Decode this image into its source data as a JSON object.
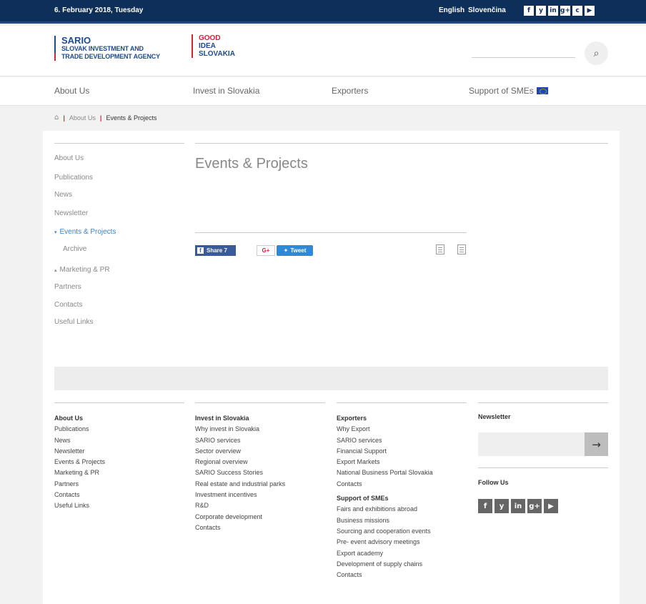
{
  "topbar": {
    "date": "6. February 2018, Tuesday",
    "lang_en": "English",
    "lang_sk": "Slovenčina",
    "social": [
      "f",
      "y",
      "in",
      "g+",
      "c",
      "▶"
    ]
  },
  "header": {
    "sario_name": "SARIO",
    "sario_sub1": "SLOVAK INVESTMENT AND",
    "sario_sub2": "TRADE DEVELOPMENT AGENCY",
    "good1": "GOOD",
    "good2": "IDEA",
    "good3": "SLOVAKIA",
    "search_icon": "⌕"
  },
  "mainnav": {
    "items": [
      "About Us",
      "Invest in Slovakia",
      "Exporters",
      "Support of SMEs"
    ]
  },
  "breadcrumb": {
    "home_icon": "⌂",
    "sep": "|",
    "items": [
      "About Us",
      "Events & Projects"
    ]
  },
  "leftnav": {
    "items": [
      "About Us",
      "Publications",
      "News",
      "Newsletter",
      "Events & Projects",
      "Archive",
      "Marketing & PR",
      "Partners",
      "Contacts",
      "Useful Links"
    ],
    "expanded_marker": "▾",
    "collapsed_marker": "▴"
  },
  "main": {
    "title": "Events & Projects",
    "share_label": "Share 7",
    "gplus_label": "G+",
    "tweet_label": "Tweet"
  },
  "footer": {
    "col1": {
      "items": [
        "About Us",
        "Publications",
        "News",
        "Newsletter",
        "Events & Projects",
        "Marketing & PR",
        "Partners",
        "Contacts",
        "Useful Links"
      ]
    },
    "col2": {
      "heading": "Invest in Slovakia",
      "items": [
        "Why invest in Slovakia",
        "SARIO services",
        "Sector overview",
        "Regional overview",
        "SARIO Success Stories",
        "Real estate and industrial parks",
        "Investment incentives",
        "R&D",
        "Corporate development",
        "Contacts"
      ]
    },
    "col3": {
      "heading": "Exporters",
      "items": [
        "Why Export",
        "SARIO services",
        "Financial Support",
        "Export Markets",
        "National Business Portal Slovakia",
        "Contacts"
      ],
      "heading2": "Support of SMEs",
      "items2": [
        "Fairs and exhibitions abroad",
        "Business missions",
        "Sourcing and cooperation events",
        "Pre- event advisory meetings",
        "Export academy",
        "Development of supply chains",
        "Contacts"
      ]
    },
    "newsletter_title": "Newsletter",
    "newsletter_arrow": "→",
    "follow_title": "Follow Us",
    "follow_icons": [
      "f",
      "y",
      "in",
      "g+",
      "▶"
    ]
  },
  "colors": {
    "topbar": "#0f2f5b",
    "accent_red": "#d6213a",
    "link_active": "#3a82c9"
  }
}
